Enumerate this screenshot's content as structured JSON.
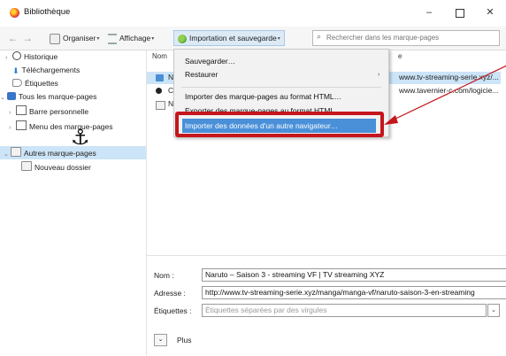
{
  "window": {
    "title": "Bibliothèque",
    "minimize": "–",
    "close": "✕"
  },
  "toolbar": {
    "back": "←",
    "forward": "→",
    "organiser": "Organiser",
    "affichage": "Affichage",
    "import": "Importation et sauvegarde",
    "dropdown_arrow": "▾",
    "search_placeholder": "Rechercher dans les marque-pages",
    "search_icon": "⌕"
  },
  "sidebar": {
    "items": [
      {
        "label": "Historique",
        "twisty": "›",
        "icon": "history-icon"
      },
      {
        "label": "Téléchargements",
        "twisty": "",
        "icon": "download-icon"
      },
      {
        "label": "Étiquettes",
        "twisty": "",
        "icon": "tag-icon"
      },
      {
        "label": "Tous les marque-pages",
        "twisty": "⌄",
        "icon": "bookmarks-star-icon"
      },
      {
        "label": "Barre personnelle",
        "twisty": "›",
        "icon": "toolbar-folder-icon"
      },
      {
        "label": "Menu des marque-pages",
        "twisty": "›",
        "icon": "menu-folder-icon"
      },
      {
        "label": "Autres marque-pages",
        "twisty": "⌄",
        "icon": "folder-icon"
      },
      {
        "label": "Nouveau dossier",
        "twisty": "",
        "icon": "folder-icon"
      }
    ],
    "overlay_icon": "⚓"
  },
  "list": {
    "header_name": "Nom",
    "header_location": "e",
    "rows": [
      {
        "name": "N",
        "url": "www.tv-streaming-serie.xyz/...",
        "icon": "page-icon"
      },
      {
        "name": "C",
        "url": "www.tavernier-c.com/logicie...",
        "icon": "site-icon"
      },
      {
        "name": "N",
        "url": "",
        "icon": "folder-icon"
      }
    ]
  },
  "menu": {
    "items": [
      {
        "label": "Sauvegarder…"
      },
      {
        "label": "Restaurer"
      },
      {
        "label": "Importer des marque-pages au format HTML…"
      },
      {
        "label": "Exporter des marque-pages au format HTML…"
      },
      {
        "label": "Importer des données d'un autre navigateur…"
      }
    ],
    "submenu_arrow": "›"
  },
  "details": {
    "name_label": "Nom :",
    "name_value": "Naruto – Saison 3 - streaming VF | TV streaming XYZ",
    "address_label": "Adresse :",
    "address_value": "http://www.tv-streaming-serie.xyz/manga/manga-vf/naruto-saison-3-en-streaming",
    "tags_label": "Étiquettes :",
    "tags_placeholder": "Étiquettes séparées par des virgules",
    "tags_dropdown": "⌄",
    "more_label": "Plus",
    "more_button": "⌄"
  },
  "colors": {
    "highlight": "#4a90d9",
    "annotation_red": "#c4161c",
    "selection": "#cce4f7"
  }
}
